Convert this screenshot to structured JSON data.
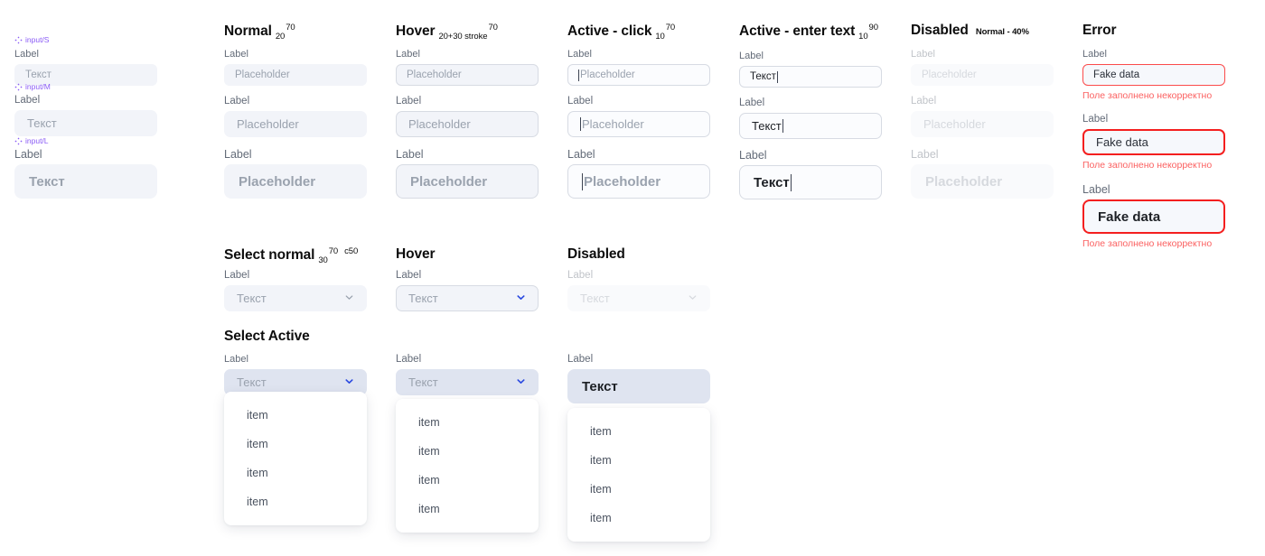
{
  "figma_tags": [
    {
      "label": "input/S",
      "icon": "component-diamond-icon"
    },
    {
      "label": "input/M",
      "icon": "component-diamond-icon"
    },
    {
      "label": "input/L",
      "icon": "component-diamond-icon"
    }
  ],
  "colors": {
    "accent_purple": "#8b5cf6",
    "accent_blue": "#2b4ae0",
    "error_border": "#f41f1f",
    "error_text": "#fb6060",
    "field_bg": "#f2f4f9",
    "field_bg_active": "#fbfcfe",
    "select_active_bg": "#dfe4f0",
    "label_text": "#636b78",
    "placeholder_text": "#9aa2ae",
    "value_text": "#1d2025"
  },
  "columns": {
    "source": {
      "fields": [
        {
          "label": "Label",
          "value": "Текст",
          "size": "s"
        },
        {
          "label": "Label",
          "value": "Текст",
          "size": "m"
        },
        {
          "label": "Label",
          "value": "Текст",
          "size": "l"
        }
      ]
    },
    "normal": {
      "title": "Normal",
      "sub": "20",
      "sup": "70",
      "fields": [
        {
          "label": "Label",
          "value": "Placeholder",
          "size": "s"
        },
        {
          "label": "Label",
          "value": "Placeholder",
          "size": "m"
        },
        {
          "label": "Label",
          "value": "Placeholder",
          "size": "l"
        }
      ]
    },
    "hover": {
      "title": "Hover",
      "sub": "20+30 stroke",
      "sup": "70",
      "fields": [
        {
          "label": "Label",
          "value": "Placeholder",
          "size": "s"
        },
        {
          "label": "Label",
          "value": "Placeholder",
          "size": "m"
        },
        {
          "label": "Label",
          "value": "Placeholder",
          "size": "l"
        }
      ]
    },
    "active_click": {
      "title": "Active - click",
      "sub": "10",
      "sup": "70",
      "fields": [
        {
          "label": "Label",
          "value": "Placeholder",
          "size": "s"
        },
        {
          "label": "Label",
          "value": "Placeholder",
          "size": "m"
        },
        {
          "label": "Label",
          "value": "Placeholder",
          "size": "l"
        }
      ]
    },
    "active_enter": {
      "title": "Active - enter text",
      "sub": "10",
      "sup": "90",
      "fields": [
        {
          "label": "Label",
          "value": "Текст",
          "size": "s"
        },
        {
          "label": "Label",
          "value": "Текст",
          "size": "m"
        },
        {
          "label": "Label",
          "value": "Текст",
          "size": "l"
        }
      ]
    },
    "disabled": {
      "title": "Disabled",
      "note": "Normal - 40%",
      "fields": [
        {
          "label": "Label",
          "value": "Placeholder",
          "size": "s"
        },
        {
          "label": "Label",
          "value": "Placeholder",
          "size": "m"
        },
        {
          "label": "Label",
          "value": "Placeholder",
          "size": "l"
        }
      ]
    },
    "error": {
      "title": "Error",
      "fields": [
        {
          "label": "Label",
          "value": "Fake data",
          "size": "s",
          "message": "Поле заполнено некорректно"
        },
        {
          "label": "Label",
          "value": "Fake data",
          "size": "m",
          "message": "Поле заполнено некорректно"
        },
        {
          "label": "Label",
          "value": "Fake data",
          "size": "l",
          "message": "Поле заполнено некорректно"
        }
      ]
    }
  },
  "selects": {
    "normal": {
      "title": "Select normal",
      "sub": "30",
      "sup": "70",
      "note2": "c50",
      "label": "Label",
      "value": "Текст",
      "icon": "chevron-down-icon"
    },
    "hover": {
      "title": "Hover",
      "label": "Label",
      "value": "Текст",
      "icon": "chevron-down-icon"
    },
    "disabled": {
      "title": "Disabled",
      "label": "Label",
      "value": "Текст",
      "icon": "chevron-down-icon"
    },
    "active": {
      "title": "Select Active",
      "variants": [
        {
          "label": "Label",
          "value": "Текст",
          "icon": "chevron-down-icon",
          "options": [
            "item",
            "item",
            "item",
            "item"
          ]
        },
        {
          "label": "Label",
          "value": "Текст",
          "icon": "chevron-down-icon",
          "options": [
            "item",
            "item",
            "item",
            "item"
          ]
        },
        {
          "label": "Label",
          "value": "Текст",
          "icon": "none",
          "options": [
            "item",
            "item",
            "item",
            "item"
          ]
        }
      ]
    }
  }
}
